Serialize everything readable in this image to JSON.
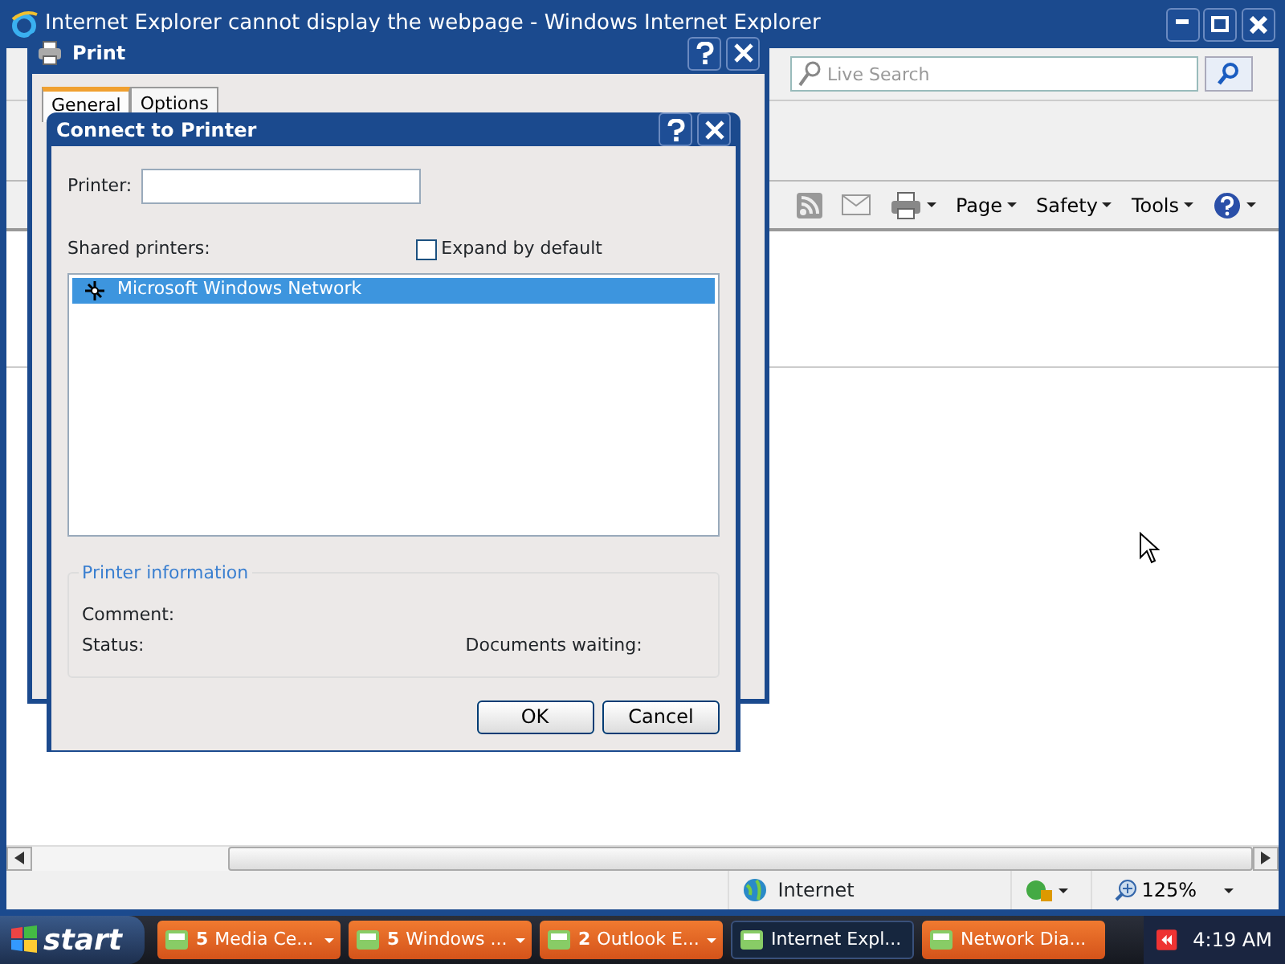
{
  "browser": {
    "title": "Internet Explorer cannot display the webpage - Windows Internet Explorer",
    "search": {
      "placeholder": "Live Search"
    },
    "command_bar": [
      {
        "kind": "feeds"
      },
      {
        "kind": "mail"
      },
      {
        "kind": "print"
      },
      {
        "kind": "menu",
        "label": "Page"
      },
      {
        "kind": "menu",
        "label": "Safety"
      },
      {
        "kind": "menu",
        "label": "Tools"
      },
      {
        "kind": "help"
      }
    ],
    "status_bar": {
      "zone": "Internet",
      "zoom": "125%"
    }
  },
  "print_dialog": {
    "title": "Print",
    "tabs": [
      {
        "label": "General",
        "selected": true
      },
      {
        "label": "Options",
        "selected": false
      }
    ]
  },
  "connect_dialog": {
    "title": "Connect to Printer",
    "printer_label": "Printer:",
    "shared_label": "Shared printers:",
    "expand": {
      "label": "Expand by default",
      "checked": false
    },
    "printers": [
      {
        "label": "Microsoft Windows Network",
        "selected": true
      }
    ],
    "info": {
      "title": "Printer information",
      "comment": "Comment:",
      "status": "Status:",
      "waiting": "Documents waiting:"
    },
    "buttons": [
      "OK",
      "Cancel"
    ]
  },
  "taskbar": {
    "start": "start",
    "items": [
      {
        "count": "5",
        "label": "Media Ce...",
        "selected": false
      },
      {
        "count": "5",
        "label": "Windows ...",
        "selected": false
      },
      {
        "count": "2",
        "label": "Outlook E...",
        "selected": false
      },
      {
        "label": "Internet Expl...",
        "selected": true
      },
      {
        "label": "Network Dia...",
        "selected": false
      }
    ],
    "clock": "4:19 AM"
  }
}
